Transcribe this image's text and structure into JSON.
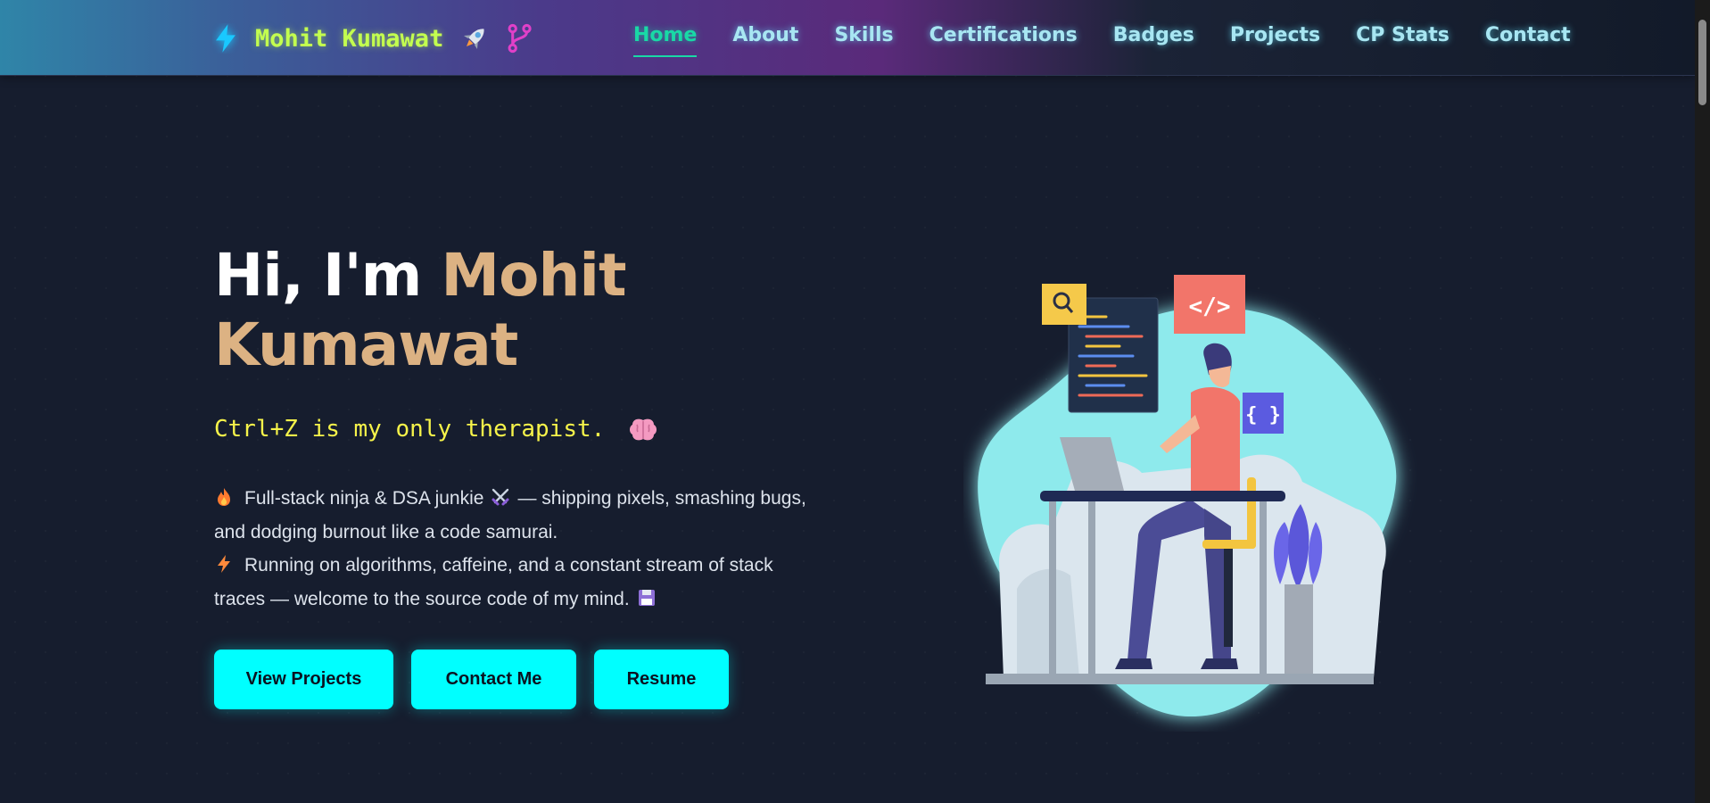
{
  "brand": {
    "name": "Mohit Kumawat",
    "accent": "#c3ff4f",
    "icons": [
      "lightning-icon",
      "rocket-icon",
      "git-branch-icon"
    ]
  },
  "nav": {
    "items": [
      {
        "label": "Home",
        "active": true
      },
      {
        "label": "About",
        "active": false
      },
      {
        "label": "Skills",
        "active": false
      },
      {
        "label": "Certifications",
        "active": false
      },
      {
        "label": "Badges",
        "active": false
      },
      {
        "label": "Projects",
        "active": false
      },
      {
        "label": "CP Stats",
        "active": false
      },
      {
        "label": "Contact",
        "active": false
      }
    ],
    "active_color": "#19d9a6",
    "link_color": "#a8e6f2"
  },
  "hero": {
    "greeting": "Hi, I'm ",
    "name": "Mohit Kumawat",
    "name_color": "#dcb283",
    "tagline": "Ctrl+Z is my only therapist.",
    "tagline_color": "#f6f34a",
    "bio_line1": "Full-stack ninja & DSA junkie",
    "bio_line1_rest": "— shipping pixels, smashing bugs, and dodging burnout like a code samurai.",
    "bio_line2": "Running on algorithms, caffeine, and a constant stream of stack traces — welcome to the source code of my mind.",
    "emoji_icons": [
      "brain-icon",
      "fire-icon",
      "swords-icon",
      "lightning-icon",
      "floppy-disk-icon"
    ]
  },
  "buttons": {
    "view_projects": "View Projects",
    "contact_me": "Contact Me",
    "resume": "Resume",
    "color": "#00ffff"
  },
  "illustration": {
    "code_tag": "</>",
    "braces": "{ }"
  }
}
